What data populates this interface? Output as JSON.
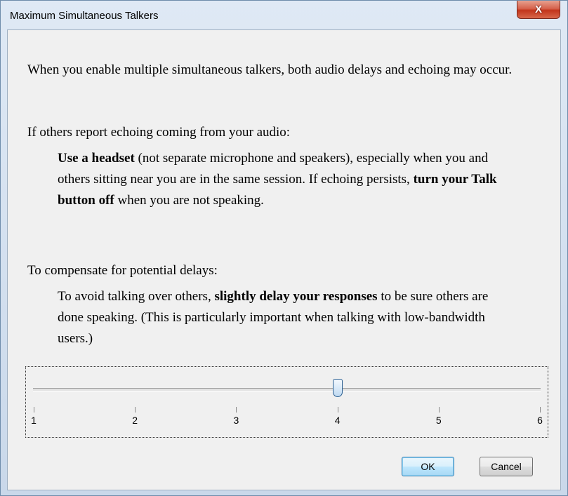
{
  "window": {
    "title": "Maximum Simultaneous Talkers",
    "close_label": "X"
  },
  "content": {
    "p1": "When you enable multiple simultaneous talkers, both audio delays and echoing may occur.",
    "p2": "If others report echoing coming from your audio:",
    "p3": {
      "bold1": "Use a headset",
      "text1": " (not separate microphone and speakers), especially when you and others sitting near you are in the same session. If echoing persists, ",
      "bold2": "turn your Talk button off",
      "text2": " when you are not speaking."
    },
    "p4": "To compensate for potential delays:",
    "p5": {
      "text1": "To avoid talking over others, ",
      "bold1": "slightly delay your responses",
      "text2": " to be sure others are done speaking. (This is particularly important when talking with low-bandwidth users.)"
    }
  },
  "slider": {
    "min": 1,
    "max": 6,
    "value": 4,
    "ticks": [
      "1",
      "2",
      "3",
      "4",
      "5",
      "6"
    ]
  },
  "buttons": {
    "ok": "OK",
    "cancel": "Cancel"
  },
  "colors": {
    "close": "#c2351b",
    "ok_border": "#3c7fb1"
  },
  "icons": {
    "close": "close-icon"
  }
}
